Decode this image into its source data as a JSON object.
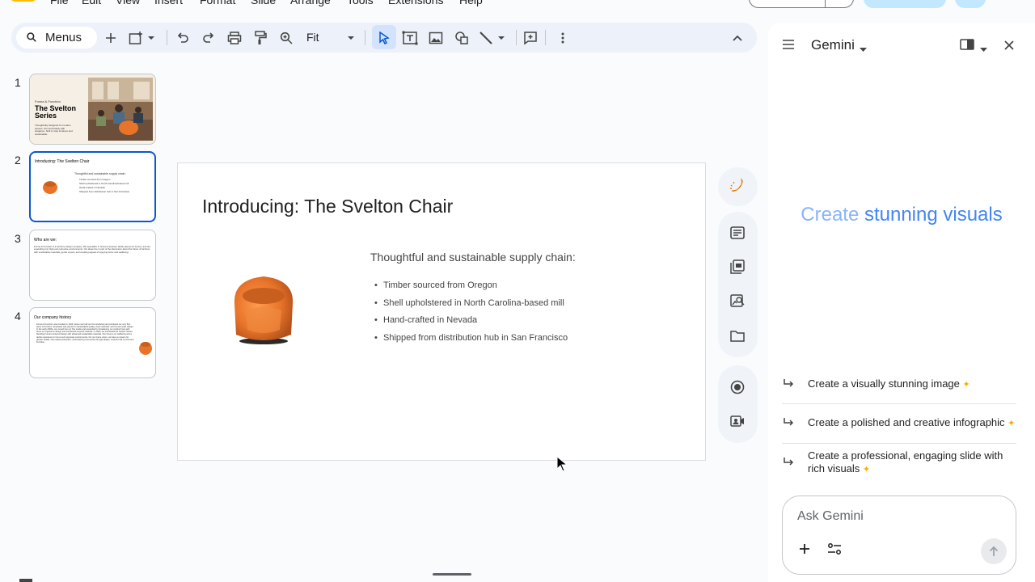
{
  "menubar": {
    "items": [
      "File",
      "Edit",
      "View",
      "Insert",
      "Format",
      "Slide",
      "Arrange",
      "Tools",
      "Extensions",
      "Help"
    ]
  },
  "toolbar": {
    "menus_label": "Menus",
    "zoom_value": "Fit"
  },
  "filmstrip": {
    "slides": [
      {
        "number": "1",
        "kicker": "Forma & Function",
        "title": "The Svelton Series",
        "body": "Thoughtfully designed for modern spaces. Sit comfortably with elegance, built to stay timeless and sustainable."
      },
      {
        "number": "2",
        "title": "Introducing: The Svelton Chair",
        "subtitle": "Thoughtful and sustainable supply chain:",
        "bullets": [
          "Timber sourced from Oregon",
          "Shell upholstered in North Carolina-based mill",
          "Hand-crafted in Nevada",
          "Shipped from distribution hub in San Francisco"
        ]
      },
      {
        "number": "3",
        "title": "Who are we:",
        "body": "Forma & Function is a furniture design company. We specialize in human-centered, tactile pieces for homes, and are expanding into high-end corporate environments. Our ideas live in part of the discussion about the future of furniture with sustainable materials, gentle curves, and a lasting appeal of enjoying focus and wellbeing."
      },
      {
        "number": "4",
        "title": "Our company history",
        "body": "Forma & Function was founded in 1949, where we built our first workshop and produced our very first piece of furniture. Emphasis was placed on handcrafted quality, local materials, and human-scale design. In the early 2000s, we moved into our first studio and expanded by broadening our product lines with focus on ergonomic design and introduced recycled material. In 2020, we introduced the Svelton Series blending human-centered design with advanced sustainable materials. Our focus is on wellbeing and a tactile experience in home and corporate environments. For our future vision, we have a mission for greater health, zero-waste production, and fostering community through design. A future built on Forma & Function."
      }
    ]
  },
  "slide": {
    "title": "Introducing: The Svelton Chair",
    "subtitle": "Thoughtful and sustainable supply chain:",
    "bullets": [
      "Timber sourced from Oregon",
      "Shell upholstered in North Carolina-based mill",
      "Hand-crafted in Nevada",
      "Shipped from distribution hub in San Francisco"
    ]
  },
  "gemini": {
    "title": "Gemini",
    "hero_part1": "Create ",
    "hero_part2": "stunning visuals",
    "suggestions": [
      "Create a visually stunning image",
      "Create a polished and creative infographic",
      "Create a professional, engaging slide with rich visuals"
    ],
    "input_placeholder": "Ask Gemini"
  },
  "colors": {
    "accent": "#0b57d0",
    "toolbar_bg": "#edf2fa",
    "chair_orange": "#e8742a",
    "hero_blue": "#4285f4"
  }
}
